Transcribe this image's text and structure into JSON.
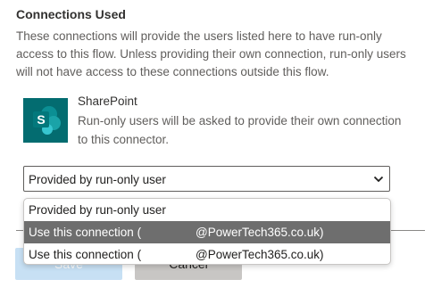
{
  "section": {
    "title": "Connections Used",
    "description": "These connections will provide the users listed here to have run-only access to this flow. Unless providing their own connection, run-only users will not have access to these connections outside this flow."
  },
  "connector": {
    "icon": "sharepoint-icon",
    "icon_color": "#036c70",
    "name": "SharePoint",
    "note": "Run-only users will be asked to provide their own connection to this connector."
  },
  "connection_select": {
    "value": "Provided by run-only user",
    "icon": "chevron-down-icon",
    "options": [
      {
        "text": "Provided by run-only user",
        "domain": ""
      },
      {
        "text": "Use this connection (",
        "domain": "@PowerTech365.co.uk)"
      },
      {
        "text": "Use this connection (",
        "domain": "@PowerTech365.co.uk)"
      }
    ],
    "highlighted_index": 1,
    "highlight_color": "#6e6e6e"
  },
  "buttons": {
    "save_label": "Save",
    "cancel_label": "Cancel"
  }
}
